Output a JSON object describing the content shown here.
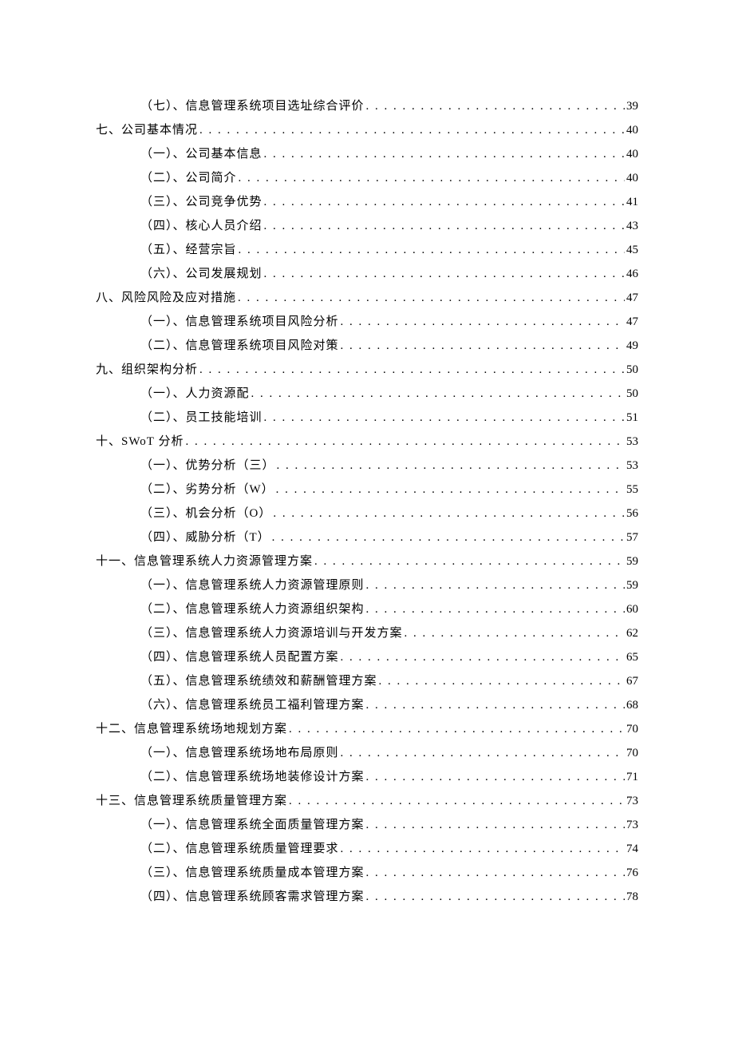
{
  "toc": [
    {
      "level": 2,
      "label": "（七）、信息管理系统项目选址综合评价",
      "page": "39"
    },
    {
      "level": 1,
      "label": "七、公司基本情况",
      "page": "40"
    },
    {
      "level": 2,
      "label": "（一）、公司基本信息",
      "page": "40"
    },
    {
      "level": 2,
      "label": "（二）、公司简介",
      "page": "40"
    },
    {
      "level": 2,
      "label": "（三）、公司竞争优势",
      "page": "41"
    },
    {
      "level": 2,
      "label": "（四）、核心人员介绍",
      "page": "43"
    },
    {
      "level": 2,
      "label": "（五）、经营宗旨",
      "page": "45"
    },
    {
      "level": 2,
      "label": "（六）、公司发展规划",
      "page": "46"
    },
    {
      "level": 1,
      "label": "八、风险风险及应对措施",
      "page": "47"
    },
    {
      "level": 2,
      "label": "（一）、信息管理系统项目风险分析",
      "page": "47"
    },
    {
      "level": 2,
      "label": "（二）、信息管理系统项目风险对策",
      "page": "49"
    },
    {
      "level": 1,
      "label": "九、组织架构分析",
      "page": "50"
    },
    {
      "level": 2,
      "label": "（一）、人力资源配",
      "page": "50"
    },
    {
      "level": 2,
      "label": "（二）、员工技能培训",
      "page": "51"
    },
    {
      "level": 1,
      "label": "十、SWoT 分析",
      "page": "53"
    },
    {
      "level": 2,
      "label": "（一）、优势分析（三）",
      "page": "53"
    },
    {
      "level": 2,
      "label": "（二）、劣势分析（W）",
      "page": "55"
    },
    {
      "level": 2,
      "label": "（三）、机会分析（O）",
      "page": "56"
    },
    {
      "level": 2,
      "label": "（四）、威胁分析（T）",
      "page": "57"
    },
    {
      "level": 1,
      "label": "十一、信息管理系统人力资源管理方案",
      "page": "59"
    },
    {
      "level": 2,
      "label": "（一）、信息管理系统人力资源管理原则",
      "page": "59"
    },
    {
      "level": 2,
      "label": "（二）、信息管理系统人力资源组织架构",
      "page": "60"
    },
    {
      "level": 2,
      "label": "（三）、信息管理系统人力资源培训与开发方案",
      "page": "62"
    },
    {
      "level": 2,
      "label": "（四）、信息管理系统人员配置方案",
      "page": "65"
    },
    {
      "level": 2,
      "label": "（五）、信息管理系统绩效和薪酬管理方案",
      "page": "67"
    },
    {
      "level": 2,
      "label": "（六）、信息管理系统员工福利管理方案",
      "page": "68"
    },
    {
      "level": 1,
      "label": "十二、信息管理系统场地规划方案",
      "page": "70"
    },
    {
      "level": 2,
      "label": "（一）、信息管理系统场地布局原则",
      "page": "70"
    },
    {
      "level": 2,
      "label": "（二）、信息管理系统场地装修设计方案",
      "page": "71"
    },
    {
      "level": 1,
      "label": "十三、信息管理系统质量管理方案",
      "page": "73"
    },
    {
      "level": 2,
      "label": "（一）、信息管理系统全面质量管理方案",
      "page": "73"
    },
    {
      "level": 2,
      "label": "（二）、信息管理系统质量管理要求",
      "page": "74"
    },
    {
      "level": 2,
      "label": "（三）、信息管理系统质量成本管理方案",
      "page": "76"
    },
    {
      "level": 2,
      "label": "（四）、信息管理系统顾客需求管理方案",
      "page": "78"
    }
  ]
}
